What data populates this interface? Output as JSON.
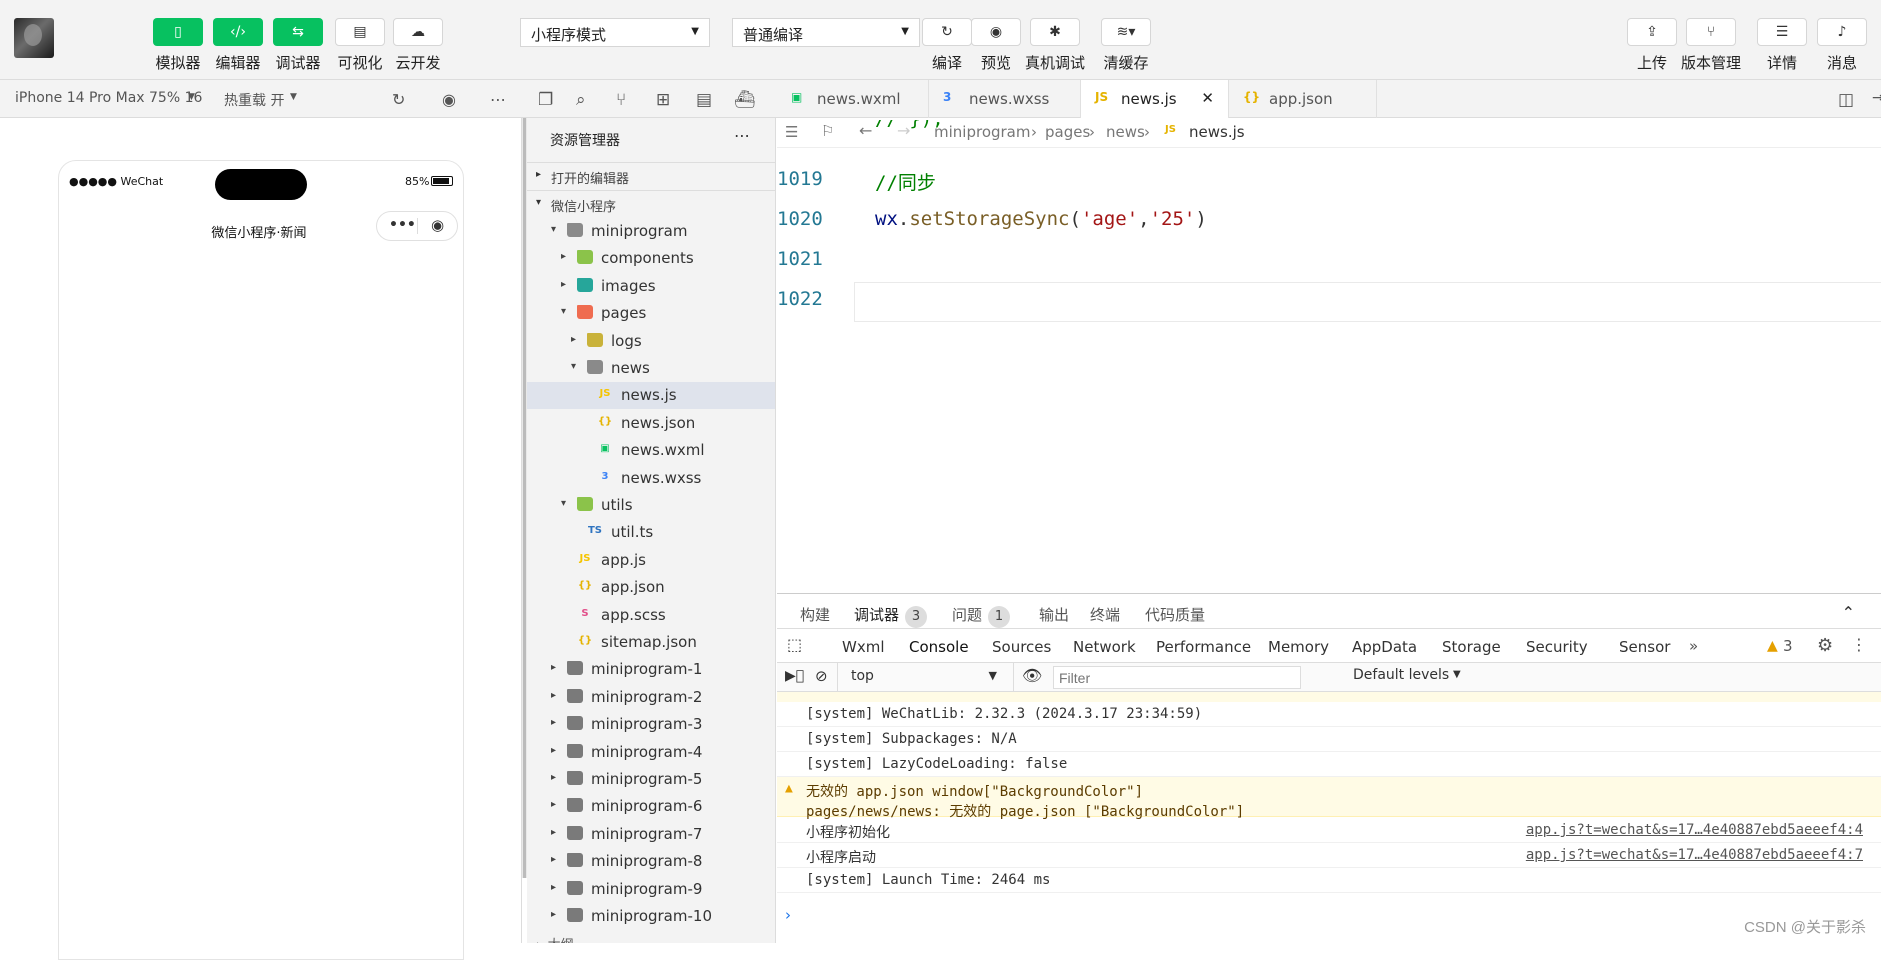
{
  "toolbar": {
    "left_buttons": [
      {
        "label": "模拟器",
        "icon": "phone-icon"
      },
      {
        "label": "编辑器",
        "icon": "code-icon"
      },
      {
        "label": "调试器",
        "icon": "debugger-icon"
      },
      {
        "label": "可视化",
        "icon": "layout-icon"
      },
      {
        "label": "云开发",
        "icon": "cloud-icon"
      }
    ],
    "mode_select": "小程序模式",
    "compile_select": "普通编译",
    "mid_buttons": [
      {
        "label": "编译",
        "icon": "refresh-icon"
      },
      {
        "label": "预览",
        "icon": "eye-icon"
      },
      {
        "label": "真机调试",
        "icon": "bug-icon"
      },
      {
        "label": "清缓存",
        "icon": "layers-icon"
      }
    ],
    "right_buttons": [
      {
        "label": "上传",
        "icon": "upload-icon"
      },
      {
        "label": "版本管理",
        "icon": "branch-icon"
      },
      {
        "label": "详情",
        "icon": "menu-icon"
      },
      {
        "label": "消息",
        "icon": "bell-icon"
      }
    ]
  },
  "subbar": {
    "device": "iPhone 14 Pro Max 75% 16",
    "hot_reload": "热重载 开"
  },
  "tabs": [
    {
      "label": "news.wxml",
      "icon": "wxml-file-icon"
    },
    {
      "label": "news.wxss",
      "icon": "css-file-icon"
    },
    {
      "label": "news.js",
      "icon": "js-file-icon"
    },
    {
      "label": "app.json",
      "icon": "json-file-icon"
    }
  ],
  "phone": {
    "signal": "●●●●● WeChat",
    "battery": "85%",
    "title": "微信小程序·新闻"
  },
  "explorer": {
    "title": "资源管理器",
    "open_editors": "打开的编辑器",
    "project": "微信小程序",
    "tree": [
      {
        "label": "miniprogram",
        "depth": 1,
        "tw": "▾",
        "type": "folder"
      },
      {
        "label": "components",
        "depth": 2,
        "tw": "▸",
        "type": "folder-green"
      },
      {
        "label": "images",
        "depth": 2,
        "tw": "▸",
        "type": "folder-teal"
      },
      {
        "label": "pages",
        "depth": 2,
        "tw": "▾",
        "type": "folder-red"
      },
      {
        "label": "logs",
        "depth": 3,
        "tw": "▸",
        "type": "folder-yellow"
      },
      {
        "label": "news",
        "depth": 3,
        "tw": "▾",
        "type": "folder"
      },
      {
        "label": "news.js",
        "depth": 4,
        "tw": "",
        "type": "js",
        "selected": true
      },
      {
        "label": "news.json",
        "depth": 4,
        "tw": "",
        "type": "json"
      },
      {
        "label": "news.wxml",
        "depth": 4,
        "tw": "",
        "type": "wxml"
      },
      {
        "label": "news.wxss",
        "depth": 4,
        "tw": "",
        "type": "wxss"
      },
      {
        "label": "utils",
        "depth": 2,
        "tw": "▾",
        "type": "folder-green"
      },
      {
        "label": "util.ts",
        "depth": 3,
        "tw": "",
        "type": "ts"
      },
      {
        "label": "app.js",
        "depth": 2,
        "tw": "",
        "type": "js"
      },
      {
        "label": "app.json",
        "depth": 2,
        "tw": "",
        "type": "json"
      },
      {
        "label": "app.scss",
        "depth": 2,
        "tw": "",
        "type": "scss"
      },
      {
        "label": "sitemap.json",
        "depth": 2,
        "tw": "",
        "type": "json"
      },
      {
        "label": "miniprogram-1",
        "depth": 1,
        "tw": "▸",
        "type": "folder-gray"
      },
      {
        "label": "miniprogram-2",
        "depth": 1,
        "tw": "▸",
        "type": "folder-gray"
      },
      {
        "label": "miniprogram-3",
        "depth": 1,
        "tw": "▸",
        "type": "folder-gray"
      },
      {
        "label": "miniprogram-4",
        "depth": 1,
        "tw": "▸",
        "type": "folder-gray"
      },
      {
        "label": "miniprogram-5",
        "depth": 1,
        "tw": "▸",
        "type": "folder-gray"
      },
      {
        "label": "miniprogram-6",
        "depth": 1,
        "tw": "▸",
        "type": "folder-gray"
      },
      {
        "label": "miniprogram-7",
        "depth": 1,
        "tw": "▸",
        "type": "folder-gray"
      },
      {
        "label": "miniprogram-8",
        "depth": 1,
        "tw": "▸",
        "type": "folder-gray"
      },
      {
        "label": "miniprogram-9",
        "depth": 1,
        "tw": "▸",
        "type": "folder-gray"
      },
      {
        "label": "miniprogram-10",
        "depth": 1,
        "tw": "▸",
        "type": "folder-gray"
      }
    ]
  },
  "breadcrumb": [
    "miniprogram",
    "pages",
    "news",
    "news.js"
  ],
  "code_lines": [
    {
      "num": "1019",
      "html": "<span style='color:#008000'>//同步</span>"
    },
    {
      "num": "1020",
      "html": "<span style='color:#001080'>wx</span>.<span style='color:#795e26'>setStorageSync</span>(<span style='color:#a31515'>'age'</span>,<span style='color:#a31515'>'25'</span>)"
    },
    {
      "num": "1021",
      "html": ""
    },
    {
      "num": "1022",
      "html": ""
    }
  ],
  "devtools": {
    "top_tabs": [
      {
        "label": "构建"
      },
      {
        "label": "调试器",
        "badge": "3"
      },
      {
        "label": "问题",
        "badge": "1"
      },
      {
        "label": "输出"
      },
      {
        "label": "终端"
      },
      {
        "label": "代码质量"
      }
    ],
    "chrome_tabs": [
      "Wxml",
      "Console",
      "Sources",
      "Network",
      "Performance",
      "Memory",
      "AppData",
      "Storage",
      "Security",
      "Sensor"
    ],
    "active_chrome_tab": "Console",
    "warn_count": "3",
    "context": "top",
    "filter_placeholder": "Filter",
    "levels": "Default levels",
    "logs": [
      {
        "text": "[system] WeChatLib: 2.32.3 (2024.3.17 23:34:59)"
      },
      {
        "text": "[system] Subpackages: N/A"
      },
      {
        "text": "[system] LazyCodeLoading: false"
      },
      {
        "text": "无效的 app.json window[\"BackgroundColor\"]",
        "text2": "pages/news/news: 无效的 page.json [\"BackgroundColor\"]",
        "warn": true
      },
      {
        "text": "小程序初始化",
        "src": "app.js?t=wechat&s=17…4e40887ebd5aeeef4:4"
      },
      {
        "text": "小程序启动",
        "src": "app.js?t=wechat&s=17…4e40887ebd5aeeef4:7"
      },
      {
        "text": "[system] Launch Time: 2464 ms"
      }
    ]
  },
  "watermark": "CSDN @关于影杀"
}
